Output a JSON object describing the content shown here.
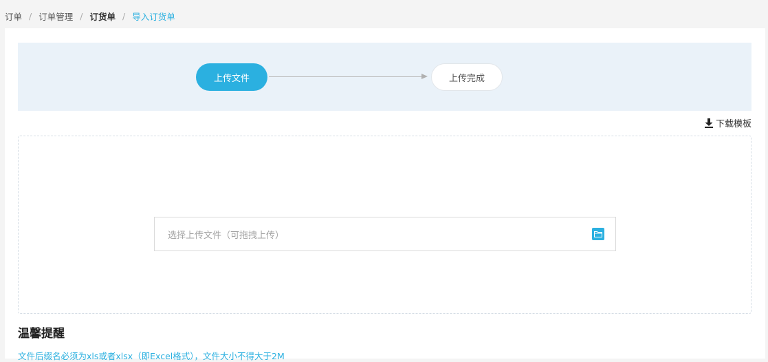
{
  "breadcrumb": {
    "items": [
      "订单",
      "订单管理",
      "订货单",
      "导入订货单"
    ],
    "separator": "/"
  },
  "steps": {
    "step1": "上传文件",
    "step2": "上传完成"
  },
  "download_template": {
    "label": "下载模板",
    "icon": "download-icon"
  },
  "upload": {
    "placeholder": "选择上传文件（可拖拽上传）",
    "icon": "folder-icon"
  },
  "tips": {
    "title": "温馨提醒",
    "text": "文件后缀名必须为xls或者xlsx（即Excel格式），文件大小不得大于2M"
  },
  "colors": {
    "accent": "#2bb0e0",
    "steps_bg": "#eaf2f9"
  }
}
